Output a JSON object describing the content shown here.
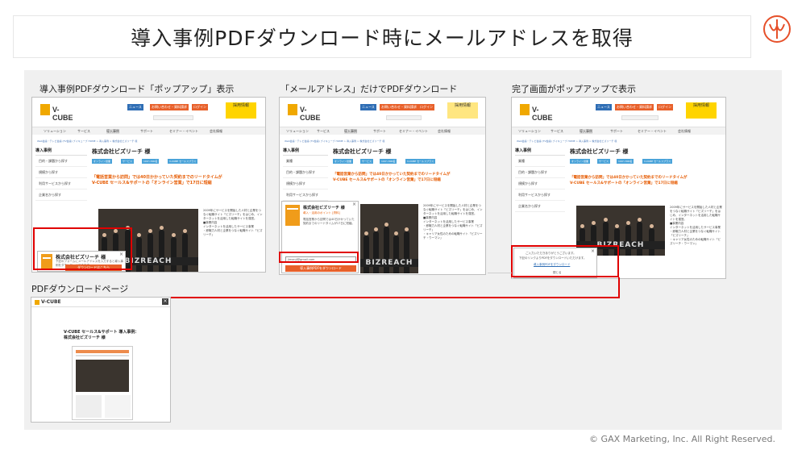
{
  "slide": {
    "title": "導入事例PDFダウンロード時にメールアドレスを取得",
    "footer": "© GAX Marketing, Inc. All Right Reserved."
  },
  "captions": {
    "popup_display": "導入事例PDFダウンロード「ポップアップ」表示",
    "email_only": "「メールアドレス」だけでPDFダウンロード",
    "completion_popup": "完了画面がポップアップで表示",
    "pdf_page": "PDFダウンロードページ"
  },
  "site": {
    "logo": "V-CUBE",
    "header_small": "SELECT REGION",
    "btn_news": "ニュース",
    "btn_inquiry": "お問い合わせ・資料請求",
    "btn_login": "ログイン",
    "recruit": "採用情報",
    "search_placeholder": "Google 検索",
    "nav": [
      "ソリューション",
      "サービス",
      "導入事例",
      "サポート",
      "セミナー・イベント",
      "会社情報",
      "企業情報"
    ],
    "breadcrumb": "Web会議・テレビ会議 (TV会議) ブイキューブ HOME > 導入事例 > 株式会社ビズリーチ 様",
    "sidebar_head": "導入事例",
    "sidebar_items": [
      "業種",
      "目的・課題から探す",
      "規模から探す",
      "利用サービスから探す",
      "企業名から探す"
    ],
    "company": "株式会社ビズリーチ 様",
    "tags": [
      "オンライン営業",
      "サービス",
      "100〜300名",
      "V-CUBE セールスプラス"
    ],
    "headline_1": "「電話営業から訪問」では40日かかっていた契約までのリードタイムが",
    "headline_2": "V-CUBE セールス&サポートの「オンライン営業」で17日に短縮",
    "photo_sign": "BIZREACH",
    "side_copy": [
      "2009年にサービスを開始した人材と企業をつなぐ転職サイト「ビズリーチ」をはじめ、インターネットを活用した転職サイトを運営。",
      "■事業内容",
      "インターネットを活用したサービス事業",
      "・即戦力人材と企業をつなぐ転職サイト「ビズリーチ」",
      "・キャリア女性のための転職サイト「ビズリーチ・ウーマン」"
    ]
  },
  "popup1": {
    "title": "株式会社ビズリーチ 様",
    "desc": "下記のフォームにメールアドレスを入力すると導入事例をダウンロードできます。",
    "button": "ダウンロードはこちら",
    "close": "×"
  },
  "popup2": {
    "title": "株式会社ビズリーチ 様",
    "subtitle": "導入・活用のポイント [資料]",
    "desc": "電話営業から訪問では40日かかっていた契約までのリードタイムが17日に短縮。",
    "email_value": "jimanji@gmail.com",
    "button": "導入事例PDFをダウンロード",
    "close": "×"
  },
  "popup3": {
    "line1": "ご入力いただきありがとうございます。",
    "line2": "下記のリンクよりPDFをダウンロードいただけます。",
    "link": "導入事例PDFをダウンロード",
    "close_label": "閉じる",
    "close": "×"
  },
  "pdf_page": {
    "logo": "V-CUBE",
    "title": "V-CUBE セールス&サポート 導入事例：株式会社ビズリーチ 様",
    "close": "×"
  },
  "colors": {
    "accent_red": "#e00000",
    "vcube_orange": "#f0a800",
    "button_orange": "#e8602a",
    "tag_blue": "#4aa3d9",
    "logo_stroke": "#e6502a"
  }
}
